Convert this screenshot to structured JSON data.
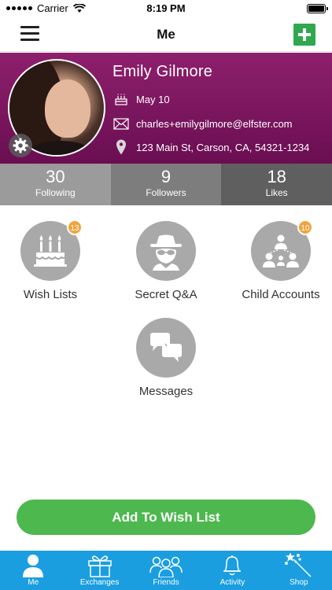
{
  "status_bar": {
    "carrier": "Carrier",
    "time": "8:19 PM"
  },
  "nav": {
    "title": "Me"
  },
  "profile": {
    "name": "Emily Gilmore",
    "birthday": "May 10",
    "email": "charles+emilygilmore@elfster.com",
    "address": "123 Main St, Carson, CA, 54321-1234"
  },
  "stats": [
    {
      "value": "30",
      "label": "Following"
    },
    {
      "value": "9",
      "label": "Followers"
    },
    {
      "value": "18",
      "label": "Likes"
    }
  ],
  "tiles": {
    "wish_lists": {
      "label": "Wish Lists",
      "badge": "13",
      "icon": "cake-icon"
    },
    "secret_qa": {
      "label": "Secret Q&A",
      "icon": "spy-icon"
    },
    "child_accounts": {
      "label": "Child Accounts",
      "badge": "10",
      "icon": "family-tree-icon"
    },
    "messages": {
      "label": "Messages",
      "icon": "chat-bubbles-icon"
    }
  },
  "actions": {
    "add_to_wish_list": "Add To Wish List"
  },
  "tabs": [
    {
      "label": "Me",
      "icon": "person-icon"
    },
    {
      "label": "Exchanges",
      "icon": "gift-icon"
    },
    {
      "label": "Friends",
      "icon": "friends-icon"
    },
    {
      "label": "Activity",
      "icon": "bell-icon"
    },
    {
      "label": "Shop",
      "icon": "magic-wand-icon"
    }
  ],
  "colors": {
    "header_purple": "#8e1f6c",
    "accent_green": "#4cb84e",
    "tab_blue": "#1a9ee0",
    "badge_orange": "#f0a43c",
    "tile_gray": "#a9a9a9"
  }
}
